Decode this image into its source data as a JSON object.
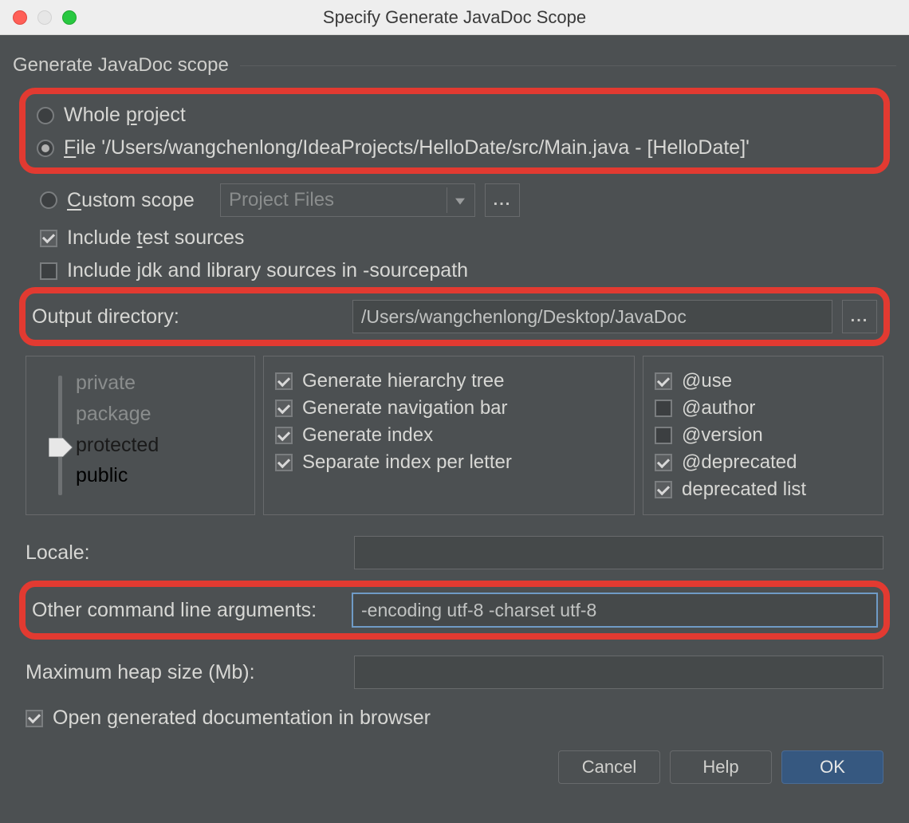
{
  "window": {
    "title": "Specify Generate JavaDoc Scope"
  },
  "group": {
    "title": "Generate JavaDoc scope"
  },
  "scope": {
    "whole_project": {
      "label_pre": "Whole ",
      "label_u": "p",
      "label_post": "roject"
    },
    "file": {
      "label_u": "F",
      "label_post": "ile '/Users/wangchenlong/IdeaProjects/HelloDate/src/Main.java - [HelloDate]'"
    },
    "custom": {
      "label_u": "C",
      "label_post": "ustom scope",
      "selected": "Project Files"
    }
  },
  "include_test": {
    "pre": "Include ",
    "u": "t",
    "post": "est sources"
  },
  "include_jdk": "Include jdk and library sources in -sourcepath",
  "outputdir": {
    "label": "Output directory:",
    "value": "/Users/wangchenlong/Desktop/JavaDoc"
  },
  "visibility": {
    "private": "private",
    "package": "package",
    "protected": "protected",
    "public": "public"
  },
  "gen_options": [
    "Generate hierarchy tree",
    "Generate navigation bar",
    "Generate index",
    "Separate index per letter"
  ],
  "tags": {
    "use": "@use",
    "author": "@author",
    "version": "@version",
    "deprecated": "@deprecated",
    "deprecated_list": "deprecated list"
  },
  "locale_label": "Locale:",
  "other_args": {
    "label": "Other command line arguments:",
    "value": "-encoding utf-8 -charset utf-8"
  },
  "heap_label": "Maximum heap size (Mb):",
  "open_browser": {
    "pre": "Open ",
    "u": "g",
    "post": "enerated documentation in browser"
  },
  "buttons": {
    "cancel": "Cancel",
    "help": "Help",
    "ok": "OK"
  },
  "ellipsis": "..."
}
